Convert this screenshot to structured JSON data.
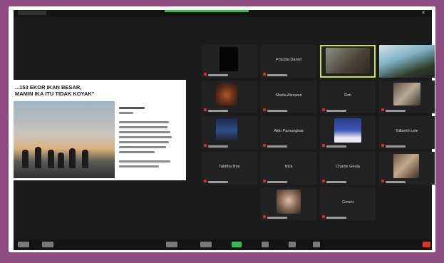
{
  "window": {
    "close_glyph": "✕"
  },
  "shared_screen": {
    "title": "...153 EKOR IKAN BESAR,\nMAMIN IKA ITU TIDAK KOYAK\""
  },
  "participants": [
    {
      "name": ""
    },
    {
      "name": "Priscilla Daniel"
    },
    {
      "name": ""
    },
    {
      "name": ""
    },
    {
      "name": ""
    },
    {
      "name": "Sheila Aleswan"
    },
    {
      "name": "Roti"
    },
    {
      "name": ""
    },
    {
      "name": ""
    },
    {
      "name": "Aldo Pamungkas"
    },
    {
      "name": ""
    },
    {
      "name": "Gilberth Lele"
    },
    {
      "name": "Tabitha Ilme"
    },
    {
      "name": "Nick"
    },
    {
      "name": "Charlie Geula"
    },
    {
      "name": ""
    },
    {
      "name": ""
    },
    {
      "name": "Ginani"
    }
  ],
  "colors": {
    "outer_border": "#8e4d80",
    "active_speaker": "#c8e34a",
    "leave_button": "#e0312a",
    "share_button": "#2fbf4a"
  }
}
